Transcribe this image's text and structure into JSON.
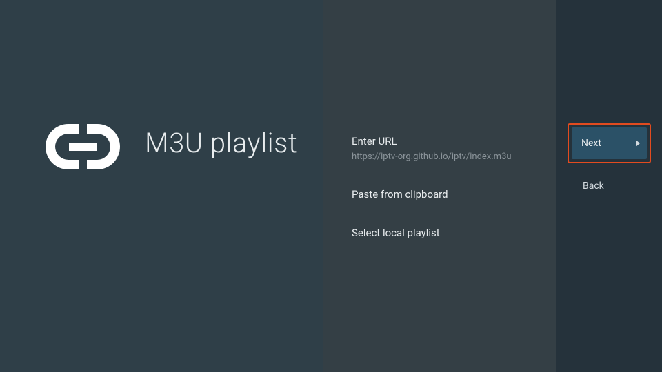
{
  "left": {
    "title": "M3U playlist"
  },
  "middle": {
    "items": [
      {
        "label": "Enter URL",
        "sublabel": "https://iptv-org.github.io/iptv/index.m3u"
      },
      {
        "label": "Paste from clipboard"
      },
      {
        "label": "Select local playlist"
      }
    ]
  },
  "right": {
    "next_label": "Next",
    "back_label": "Back"
  },
  "colors": {
    "left_bg": "#2f3f48",
    "middle_bg": "#343f45",
    "right_bg": "#25323b",
    "highlight_border": "#e24b1f",
    "button_bg": "#2b5167"
  }
}
